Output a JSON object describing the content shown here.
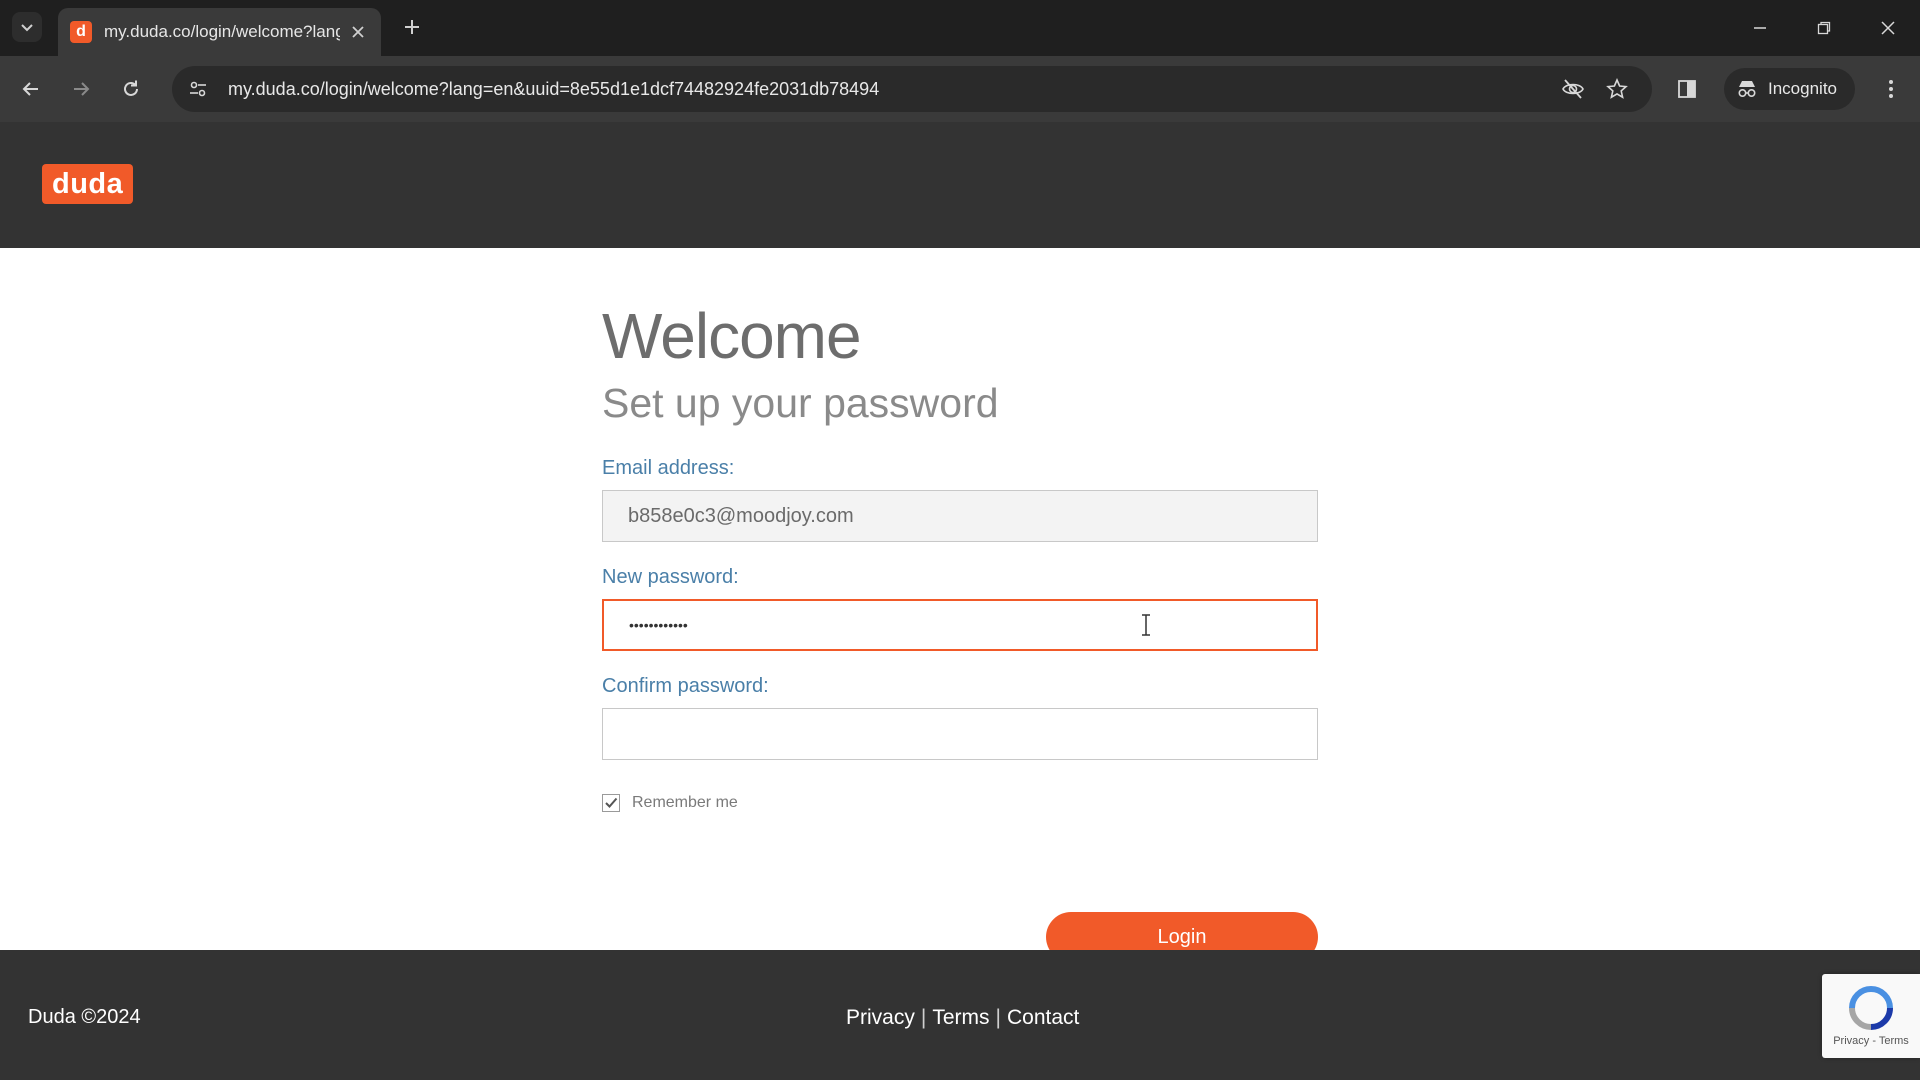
{
  "browser": {
    "tab_title": "my.duda.co/login/welcome?lang=en",
    "favicon_letter": "d",
    "url": "my.duda.co/login/welcome?lang=en&uuid=8e55d1e1dcf74482924fe2031db78494",
    "incognito_label": "Incognito"
  },
  "header": {
    "logo_text": "duda",
    "brand_color": "#f15a29"
  },
  "form": {
    "title": "Welcome",
    "subtitle": "Set up your password",
    "email_label": "Email address:",
    "email_value": "b858e0c3@moodjoy.com",
    "new_password_label": "New password:",
    "new_password_value": "••••••••••••",
    "confirm_password_label": "Confirm password:",
    "confirm_password_value": "",
    "remember_label": "Remember me",
    "remember_checked": true,
    "login_label": "Login"
  },
  "footer": {
    "copyright": "Duda ©2024",
    "privacy": "Privacy",
    "terms": "Terms",
    "contact": "Contact",
    "separator": "|",
    "recaptcha_text": "Privacy - Terms"
  }
}
